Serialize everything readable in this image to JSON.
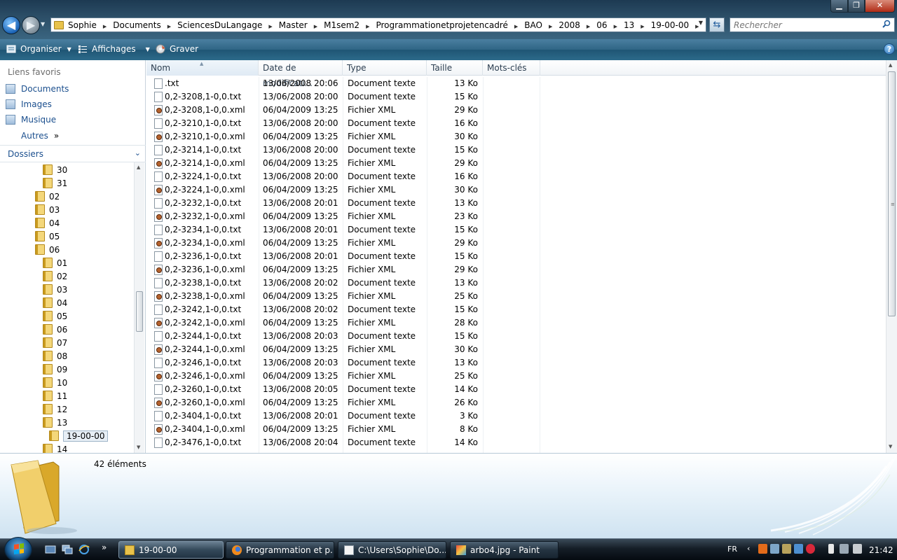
{
  "window": {
    "title_buttons": {
      "minimize": "▁",
      "maximize": "❐",
      "close": "✕"
    }
  },
  "address": {
    "crumbs": [
      "Sophie",
      "Documents",
      "SciencesDuLangage",
      "Master",
      "M1sem2",
      "Programmationetprojetencadré",
      "BAO",
      "2008",
      "06",
      "13",
      "19-00-00"
    ]
  },
  "search": {
    "placeholder": "Rechercher"
  },
  "commandbar": {
    "organize": "Organiser",
    "views": "Affichages",
    "burn": "Graver"
  },
  "favorites": {
    "heading": "Liens favoris",
    "items": [
      {
        "label": "Documents",
        "icon": "documents-icon"
      },
      {
        "label": "Images",
        "icon": "pictures-icon"
      },
      {
        "label": "Musique",
        "icon": "music-icon"
      }
    ],
    "other": "Autres"
  },
  "folders": {
    "label": "Dossiers",
    "tree": [
      {
        "label": "30",
        "level": 2
      },
      {
        "label": "31",
        "level": 2
      },
      {
        "label": "02",
        "level": 1
      },
      {
        "label": "03",
        "level": 1
      },
      {
        "label": "04",
        "level": 1
      },
      {
        "label": "05",
        "level": 1
      },
      {
        "label": "06",
        "level": 1
      },
      {
        "label": "01",
        "level": 2
      },
      {
        "label": "02",
        "level": 2
      },
      {
        "label": "03",
        "level": 2
      },
      {
        "label": "04",
        "level": 2
      },
      {
        "label": "05",
        "level": 2
      },
      {
        "label": "06",
        "level": 2
      },
      {
        "label": "07",
        "level": 2
      },
      {
        "label": "08",
        "level": 2
      },
      {
        "label": "09",
        "level": 2
      },
      {
        "label": "10",
        "level": 2
      },
      {
        "label": "11",
        "level": 2
      },
      {
        "label": "12",
        "level": 2
      },
      {
        "label": "13",
        "level": 2
      },
      {
        "label": "19-00-00",
        "level": 3,
        "selected": true
      },
      {
        "label": "14",
        "level": 2
      }
    ]
  },
  "columns": {
    "name": "Nom",
    "date": "Date de modificati...",
    "type": "Type",
    "size": "Taille",
    "tags": "Mots-clés"
  },
  "files": [
    {
      "name": ".txt",
      "date": "13/06/2008 20:06",
      "type": "Document texte",
      "size": "13 Ko",
      "kind": "txt"
    },
    {
      "name": "0,2-3208,1-0,0.txt",
      "date": "13/06/2008 20:00",
      "type": "Document texte",
      "size": "15 Ko",
      "kind": "txt"
    },
    {
      "name": "0,2-3208,1-0,0.xml",
      "date": "06/04/2009 13:25",
      "type": "Fichier XML",
      "size": "29 Ko",
      "kind": "xml"
    },
    {
      "name": "0,2-3210,1-0,0.txt",
      "date": "13/06/2008 20:00",
      "type": "Document texte",
      "size": "16 Ko",
      "kind": "txt"
    },
    {
      "name": "0,2-3210,1-0,0.xml",
      "date": "06/04/2009 13:25",
      "type": "Fichier XML",
      "size": "30 Ko",
      "kind": "xml"
    },
    {
      "name": "0,2-3214,1-0,0.txt",
      "date": "13/06/2008 20:00",
      "type": "Document texte",
      "size": "15 Ko",
      "kind": "txt"
    },
    {
      "name": "0,2-3214,1-0,0.xml",
      "date": "06/04/2009 13:25",
      "type": "Fichier XML",
      "size": "29 Ko",
      "kind": "xml"
    },
    {
      "name": "0,2-3224,1-0,0.txt",
      "date": "13/06/2008 20:00",
      "type": "Document texte",
      "size": "16 Ko",
      "kind": "txt"
    },
    {
      "name": "0,2-3224,1-0,0.xml",
      "date": "06/04/2009 13:25",
      "type": "Fichier XML",
      "size": "30 Ko",
      "kind": "xml"
    },
    {
      "name": "0,2-3232,1-0,0.txt",
      "date": "13/06/2008 20:01",
      "type": "Document texte",
      "size": "13 Ko",
      "kind": "txt"
    },
    {
      "name": "0,2-3232,1-0,0.xml",
      "date": "06/04/2009 13:25",
      "type": "Fichier XML",
      "size": "23 Ko",
      "kind": "xml"
    },
    {
      "name": "0,2-3234,1-0,0.txt",
      "date": "13/06/2008 20:01",
      "type": "Document texte",
      "size": "15 Ko",
      "kind": "txt"
    },
    {
      "name": "0,2-3234,1-0,0.xml",
      "date": "06/04/2009 13:25",
      "type": "Fichier XML",
      "size": "29 Ko",
      "kind": "xml"
    },
    {
      "name": "0,2-3236,1-0,0.txt",
      "date": "13/06/2008 20:01",
      "type": "Document texte",
      "size": "15 Ko",
      "kind": "txt"
    },
    {
      "name": "0,2-3236,1-0,0.xml",
      "date": "06/04/2009 13:25",
      "type": "Fichier XML",
      "size": "29 Ko",
      "kind": "xml"
    },
    {
      "name": "0,2-3238,1-0,0.txt",
      "date": "13/06/2008 20:02",
      "type": "Document texte",
      "size": "13 Ko",
      "kind": "txt"
    },
    {
      "name": "0,2-3238,1-0,0.xml",
      "date": "06/04/2009 13:25",
      "type": "Fichier XML",
      "size": "25 Ko",
      "kind": "xml"
    },
    {
      "name": "0,2-3242,1-0,0.txt",
      "date": "13/06/2008 20:02",
      "type": "Document texte",
      "size": "15 Ko",
      "kind": "txt"
    },
    {
      "name": "0,2-3242,1-0,0.xml",
      "date": "06/04/2009 13:25",
      "type": "Fichier XML",
      "size": "28 Ko",
      "kind": "xml"
    },
    {
      "name": "0,2-3244,1-0,0.txt",
      "date": "13/06/2008 20:03",
      "type": "Document texte",
      "size": "15 Ko",
      "kind": "txt"
    },
    {
      "name": "0,2-3244,1-0,0.xml",
      "date": "06/04/2009 13:25",
      "type": "Fichier XML",
      "size": "30 Ko",
      "kind": "xml"
    },
    {
      "name": "0,2-3246,1-0,0.txt",
      "date": "13/06/2008 20:03",
      "type": "Document texte",
      "size": "13 Ko",
      "kind": "txt"
    },
    {
      "name": "0,2-3246,1-0,0.xml",
      "date": "06/04/2009 13:25",
      "type": "Fichier XML",
      "size": "25 Ko",
      "kind": "xml"
    },
    {
      "name": "0,2-3260,1-0,0.txt",
      "date": "13/06/2008 20:05",
      "type": "Document texte",
      "size": "14 Ko",
      "kind": "txt"
    },
    {
      "name": "0,2-3260,1-0,0.xml",
      "date": "06/04/2009 13:25",
      "type": "Fichier XML",
      "size": "26 Ko",
      "kind": "xml"
    },
    {
      "name": "0,2-3404,1-0,0.txt",
      "date": "13/06/2008 20:01",
      "type": "Document texte",
      "size": "3 Ko",
      "kind": "txt"
    },
    {
      "name": "0,2-3404,1-0,0.xml",
      "date": "06/04/2009 13:25",
      "type": "Fichier XML",
      "size": "8 Ko",
      "kind": "xml"
    },
    {
      "name": "0,2-3476,1-0,0.txt",
      "date": "13/06/2008 20:04",
      "type": "Document texte",
      "size": "14 Ko",
      "kind": "txt"
    }
  ],
  "details": {
    "count": "42 éléments"
  },
  "taskbar": {
    "tasks": [
      {
        "label": "19-00-00",
        "icon": "explorer-folder-icon",
        "active": true
      },
      {
        "label": "Programmation et p...",
        "icon": "firefox-icon",
        "active": false
      },
      {
        "label": "C:\\Users\\Sophie\\Do...",
        "icon": "notepad-icon",
        "active": false
      },
      {
        "label": "arbo4.jpg - Paint",
        "icon": "paint-icon",
        "active": false
      }
    ],
    "quicklaunch_more": "»",
    "language": "FR",
    "tray_arrow": "‹",
    "clock": "21:42"
  },
  "colors": {
    "link": "#1b4f8e",
    "accent": "#2f6585"
  }
}
